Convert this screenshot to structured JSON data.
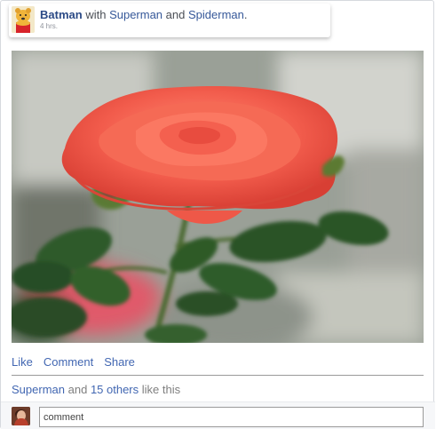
{
  "post": {
    "author": "Batman",
    "with_text": "with",
    "tagged_1": "Superman",
    "and_text": "and",
    "tagged_2": "Spiderman",
    "period": ".",
    "time": "4 hrs."
  },
  "actions": {
    "like": "Like",
    "comment": "Comment",
    "share": "Share"
  },
  "likes": {
    "first": "Superman",
    "and_text": "and",
    "others": "15 others",
    "suffix": "like this"
  },
  "comment_box": {
    "placeholder": "comment"
  },
  "colors": {
    "link": "#4267b2",
    "author": "#2b4a86",
    "rose": "#f0574a"
  },
  "icons": {
    "author_avatar": "winnie-the-pooh-avatar",
    "commenter_avatar": "user-photo-avatar"
  }
}
